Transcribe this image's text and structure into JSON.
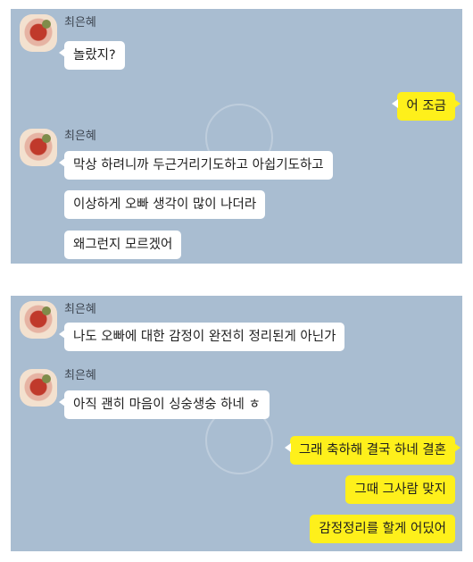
{
  "screenshot_1": {
    "messages": [
      {
        "sender": "최은혜",
        "text": "놀랐지?"
      },
      {
        "mine": true,
        "text": "어 조금"
      },
      {
        "sender": "최은혜",
        "text": "막상 하려니까 두근거리기도하고 아쉽기도하고"
      },
      {
        "text": "이상하게 오빠 생각이 많이 나더라"
      },
      {
        "text": "왜그런지 모르겠어"
      }
    ]
  },
  "screenshot_2": {
    "messages": [
      {
        "sender": "최은혜",
        "text": "나도 오빠에 대한 감정이 완전히 정리된게 아닌가"
      },
      {
        "sender": "최은혜",
        "text": "아직 괜히 마음이 싱숭생숭 하네 ㅎ"
      },
      {
        "mine": true,
        "text": "그래 축하해 결국 하네 결혼"
      },
      {
        "mine": true,
        "text": "그때 그사람 맞지"
      },
      {
        "mine": true,
        "text": "감정정리를 할게 어딨어"
      }
    ]
  },
  "colors": {
    "background": "#a9bdd1",
    "my_bubble": "#fef01b",
    "their_bubble": "#ffffff"
  },
  "icons": [
    "avatar-photo"
  ]
}
